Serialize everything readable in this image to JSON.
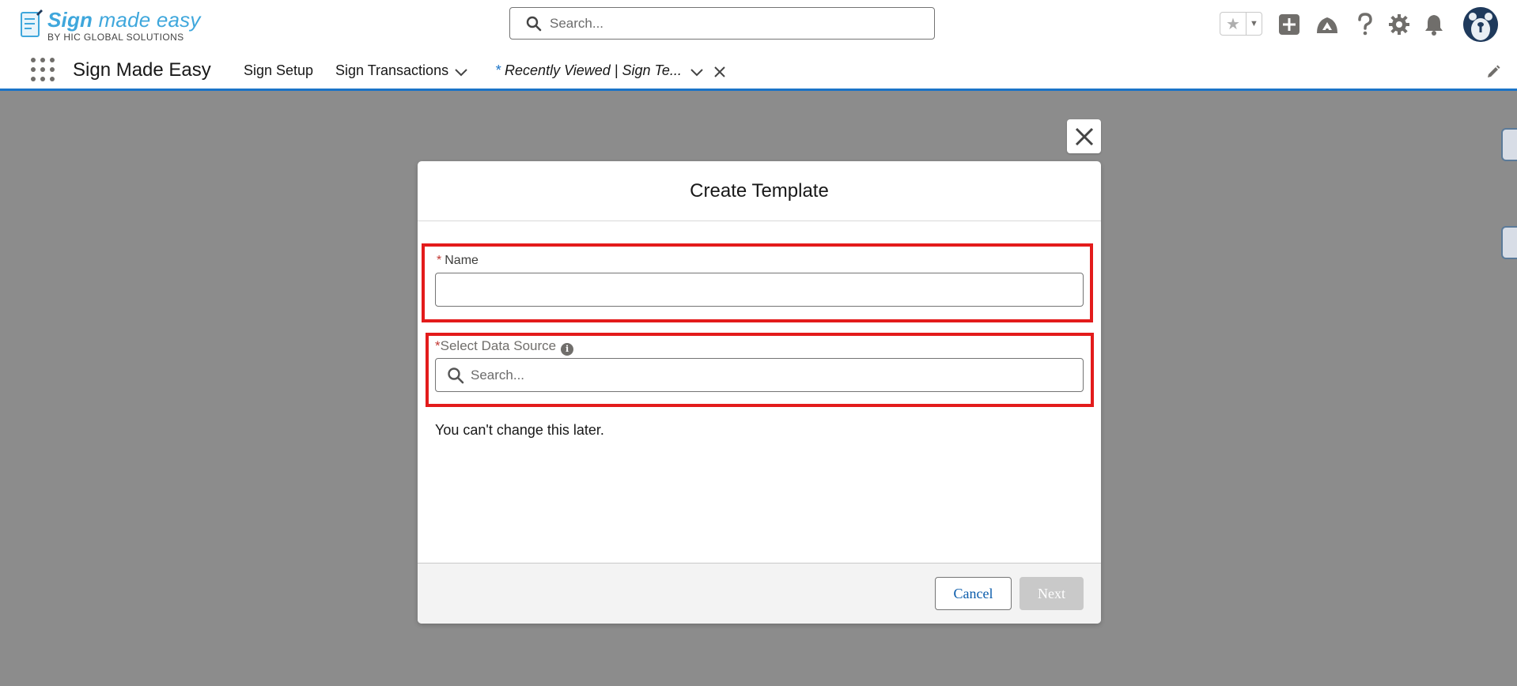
{
  "header": {
    "logo": {
      "main_bold": "Sign",
      "main_light": " made easy",
      "sub": "BY HIC GLOBAL SOLUTIONS"
    },
    "search_placeholder": "Search...",
    "icons": [
      "star-icon",
      "chevron-down-icon",
      "add-icon",
      "trailhead-icon",
      "help-icon",
      "setup-gear-icon",
      "notification-bell-icon",
      "avatar"
    ]
  },
  "nav": {
    "app_name": "Sign Made Easy",
    "items": [
      {
        "label": "Sign Setup"
      },
      {
        "label": "Sign Transactions"
      }
    ],
    "active_tab": {
      "star": "*",
      "label": "Recently Viewed | Sign Te..."
    }
  },
  "modal": {
    "title": "Create Template",
    "name_field": {
      "required": "*",
      "label": "Name",
      "value": ""
    },
    "data_source_field": {
      "required": "*",
      "label": "Select Data Source",
      "placeholder": "Search..."
    },
    "helper_text": "You can't change this later.",
    "cancel_label": "Cancel",
    "next_label": "Next"
  },
  "colors": {
    "accent": "#1b73c7",
    "highlight": "#e31b1b",
    "overlay": "#8c8c8c"
  }
}
